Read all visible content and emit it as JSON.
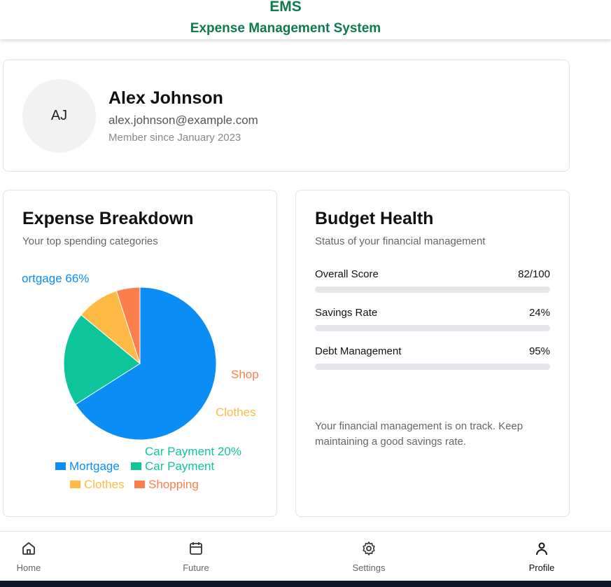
{
  "header": {
    "app_short": "EMS",
    "app_name": "Expense Management System"
  },
  "profile": {
    "initials": "AJ",
    "name": "Alex Johnson",
    "email": "alex.johnson@example.com",
    "member_since": "Member since January 2023"
  },
  "expense": {
    "title": "Expense Breakdown",
    "subtitle": "Your top spending categories",
    "chart_data": {
      "type": "pie",
      "categories": [
        "Mortgage",
        "Car Payment",
        "Clothes",
        "Shopping"
      ],
      "values": [
        66,
        20,
        9,
        5
      ],
      "slice_labels": [
        "ortgage 66%",
        "Car Payment 20%",
        "Clothes",
        "Shop"
      ],
      "colors": [
        "#0a8df5",
        "#0ec49a",
        "#ffba45",
        "#fb7f4d"
      ],
      "legend_position": "bottom"
    }
  },
  "budget": {
    "title": "Budget Health",
    "subtitle": "Status of your financial management",
    "metrics": [
      {
        "label": "Overall Score",
        "value": "82/100",
        "progress": 0
      },
      {
        "label": "Savings Rate",
        "value": "24%",
        "progress": 0
      },
      {
        "label": "Debt Management",
        "value": "95%",
        "progress": 0
      }
    ],
    "note": "Your financial management is on track. Keep maintaining a good savings rate."
  },
  "nav": {
    "items": [
      {
        "label": "Home",
        "icon": "home-icon",
        "active": false
      },
      {
        "label": "Future",
        "icon": "calendar-icon",
        "active": false
      },
      {
        "label": "Settings",
        "icon": "gear-icon",
        "active": false
      },
      {
        "label": "Profile",
        "icon": "user-icon",
        "active": true
      }
    ]
  }
}
